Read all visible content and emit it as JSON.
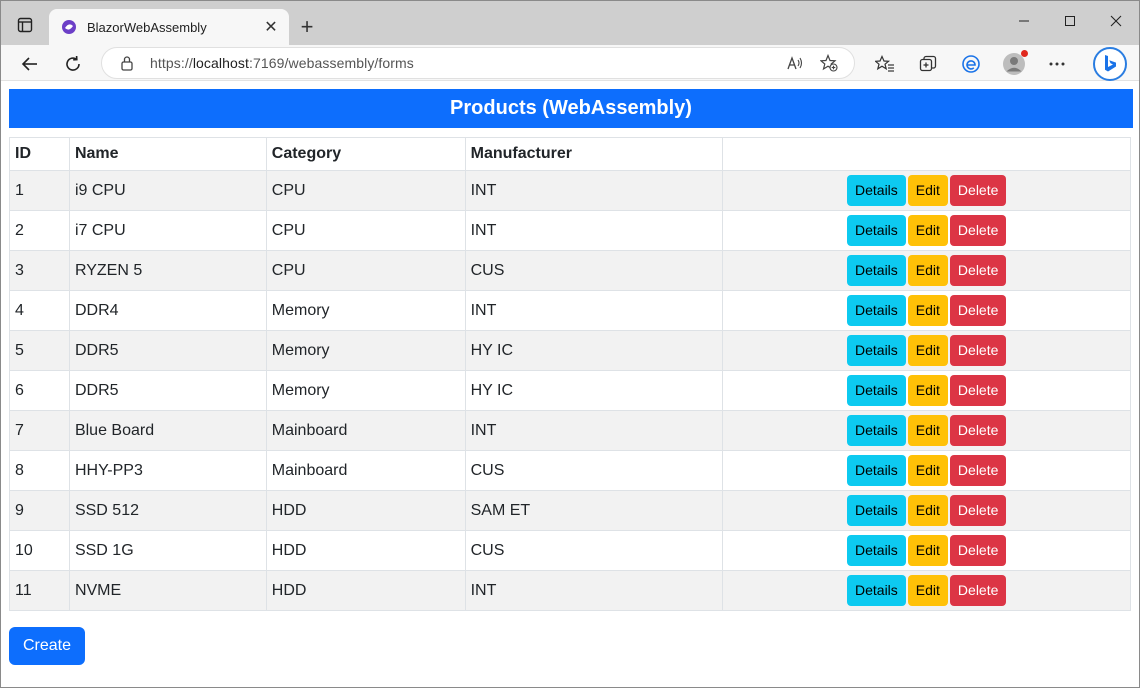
{
  "browser": {
    "tab_title": "BlazorWebAssembly",
    "url_scheme": "https://",
    "url_host": "localhost",
    "url_rest": ":7169/webassembly/forms",
    "colors": {
      "accent": "#0d6efd"
    }
  },
  "page": {
    "header": "Products (WebAssembly)",
    "columns": [
      "ID",
      "Name",
      "Category",
      "Manufacturer",
      ""
    ],
    "buttons": {
      "details": "Details",
      "edit": "Edit",
      "delete": "Delete"
    },
    "create_label": "Create",
    "rows": [
      {
        "id": "1",
        "name": "i9 CPU",
        "category": "CPU",
        "manufacturer": "INT"
      },
      {
        "id": "2",
        "name": "i7 CPU",
        "category": "CPU",
        "manufacturer": "INT"
      },
      {
        "id": "3",
        "name": "RYZEN 5",
        "category": "CPU",
        "manufacturer": "CUS"
      },
      {
        "id": "4",
        "name": "DDR4",
        "category": "Memory",
        "manufacturer": "INT"
      },
      {
        "id": "5",
        "name": "DDR5",
        "category": "Memory",
        "manufacturer": "HY IC"
      },
      {
        "id": "6",
        "name": "DDR5",
        "category": "Memory",
        "manufacturer": "HY IC"
      },
      {
        "id": "7",
        "name": "Blue Board",
        "category": "Mainboard",
        "manufacturer": "INT"
      },
      {
        "id": "8",
        "name": "HHY-PP3",
        "category": "Mainboard",
        "manufacturer": "CUS"
      },
      {
        "id": "9",
        "name": "SSD 512",
        "category": "HDD",
        "manufacturer": "SAM ET"
      },
      {
        "id": "10",
        "name": "SSD 1G",
        "category": "HDD",
        "manufacturer": "CUS"
      },
      {
        "id": "11",
        "name": "NVME",
        "category": "HDD",
        "manufacturer": "INT"
      }
    ]
  }
}
